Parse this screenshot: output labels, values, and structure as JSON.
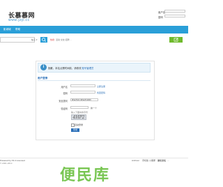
{
  "header": {
    "logo_text": "长慕慕网",
    "logo_sub": "www.jzp.cc",
    "username_label": "用户名",
    "password_label": "密码",
    "link_register": "注册",
    "link_forgot": "找回"
  },
  "nav": {
    "items": [
      "影城城",
      "帮助"
    ]
  },
  "search": {
    "placeholder": "",
    "category": "帖子 ▾",
    "hot_label": "热搜:",
    "hot_items": "活动  交友  招聘  ..."
  },
  "notice": {
    "text": "抱歉，本站点需时间前，请修改",
    "link": "账号管理员"
  },
  "form": {
    "section_title": "用户登录",
    "username_label": "用户名",
    "username_hint": "立即注册",
    "password_label": "密码",
    "password_hint": "找回密码",
    "question_label": "安全提问",
    "question_value": "未设置可以未设置(选择)",
    "answer_label": "验证码",
    "captcha_refresh": "换一个",
    "captcha_hint": "输入下图中的字符",
    "captcha_text": "4HP2",
    "remember_label": "自动登录",
    "submit_label": "登录"
  },
  "footer": {
    "left_text": "Powered by X3.4 Licensed",
    "left_sub": "© 2001-2013",
    "right_items": [
      "Archiver",
      "手机版",
      "小黑屋",
      "湖北论坛",
      "..."
    ]
  },
  "watermark": "便民库"
}
